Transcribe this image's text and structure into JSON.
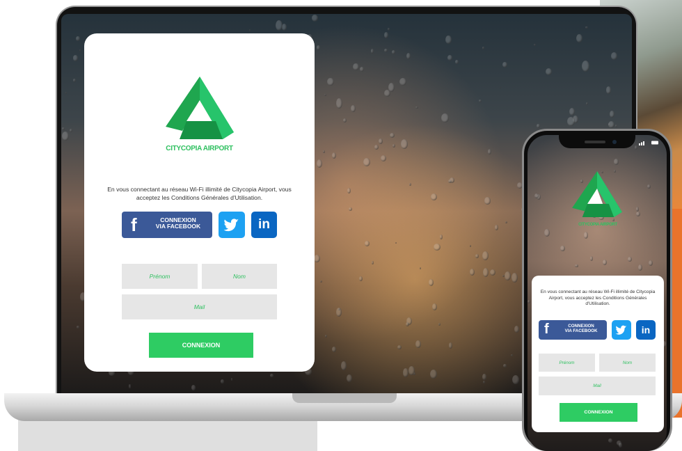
{
  "brand": {
    "name": "CITYCOPIA AIRPORT",
    "color": "#2fc060"
  },
  "laptop_portal": {
    "info_text": "En vous connectant au réseau Wi-Fi illimité de Citycopia Airport, vous acceptez les Conditions Générales d'Utilisation.",
    "facebook_label": [
      "CONNEXION",
      "VIA FACEBOOK"
    ],
    "twitter_icon": "twitter-bird-icon",
    "linkedin_label": "in",
    "first_name_placeholder": "Prénom",
    "last_name_placeholder": "Nom",
    "email_placeholder": "Mail",
    "submit_label": "CONNEXION"
  },
  "phone_portal": {
    "info_text": "En vous connectant au réseau Wi-Fi illimité de Citycopia Airport, vous acceptez les Conditions Générales d'Utilisation.",
    "facebook_label": [
      "CONNEXION",
      "VIA FACEBOOK"
    ],
    "linkedin_label": "in",
    "first_name_placeholder": "Prénom",
    "last_name_placeholder": "Nom",
    "email_placeholder": "Mail",
    "submit_label": "CONNEXION"
  },
  "colors": {
    "facebook": "#3b5998",
    "twitter": "#1da1f2",
    "linkedin": "#0a66c2",
    "submit": "#2ecc63",
    "input_bg": "#e6e6e6"
  }
}
